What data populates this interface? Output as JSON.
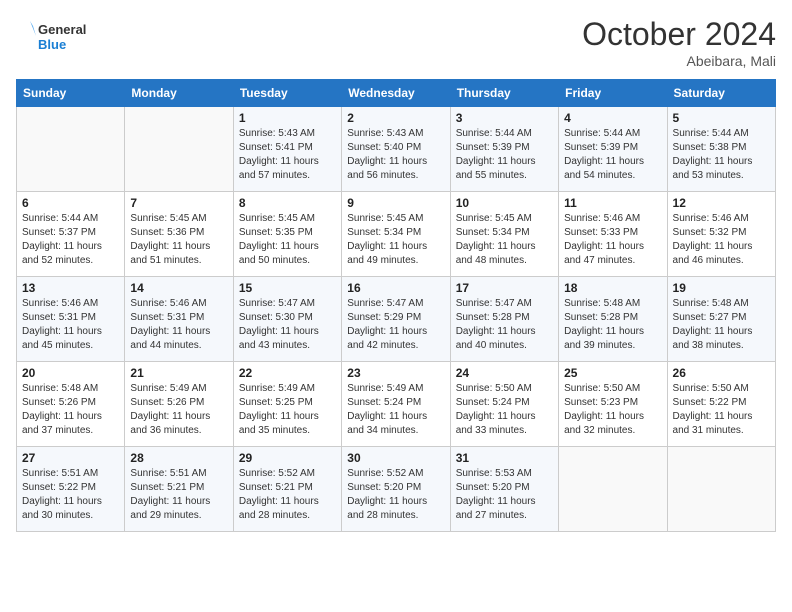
{
  "logo": {
    "text_general": "General",
    "text_blue": "Blue"
  },
  "header": {
    "month": "October 2024",
    "location": "Abeibara, Mali"
  },
  "weekdays": [
    "Sunday",
    "Monday",
    "Tuesday",
    "Wednesday",
    "Thursday",
    "Friday",
    "Saturday"
  ],
  "weeks": [
    [
      {
        "day": "",
        "sunrise": "",
        "sunset": "",
        "daylight": ""
      },
      {
        "day": "",
        "sunrise": "",
        "sunset": "",
        "daylight": ""
      },
      {
        "day": "1",
        "sunrise": "Sunrise: 5:43 AM",
        "sunset": "Sunset: 5:41 PM",
        "daylight": "Daylight: 11 hours and 57 minutes."
      },
      {
        "day": "2",
        "sunrise": "Sunrise: 5:43 AM",
        "sunset": "Sunset: 5:40 PM",
        "daylight": "Daylight: 11 hours and 56 minutes."
      },
      {
        "day": "3",
        "sunrise": "Sunrise: 5:44 AM",
        "sunset": "Sunset: 5:39 PM",
        "daylight": "Daylight: 11 hours and 55 minutes."
      },
      {
        "day": "4",
        "sunrise": "Sunrise: 5:44 AM",
        "sunset": "Sunset: 5:39 PM",
        "daylight": "Daylight: 11 hours and 54 minutes."
      },
      {
        "day": "5",
        "sunrise": "Sunrise: 5:44 AM",
        "sunset": "Sunset: 5:38 PM",
        "daylight": "Daylight: 11 hours and 53 minutes."
      }
    ],
    [
      {
        "day": "6",
        "sunrise": "Sunrise: 5:44 AM",
        "sunset": "Sunset: 5:37 PM",
        "daylight": "Daylight: 11 hours and 52 minutes."
      },
      {
        "day": "7",
        "sunrise": "Sunrise: 5:45 AM",
        "sunset": "Sunset: 5:36 PM",
        "daylight": "Daylight: 11 hours and 51 minutes."
      },
      {
        "day": "8",
        "sunrise": "Sunrise: 5:45 AM",
        "sunset": "Sunset: 5:35 PM",
        "daylight": "Daylight: 11 hours and 50 minutes."
      },
      {
        "day": "9",
        "sunrise": "Sunrise: 5:45 AM",
        "sunset": "Sunset: 5:34 PM",
        "daylight": "Daylight: 11 hours and 49 minutes."
      },
      {
        "day": "10",
        "sunrise": "Sunrise: 5:45 AM",
        "sunset": "Sunset: 5:34 PM",
        "daylight": "Daylight: 11 hours and 48 minutes."
      },
      {
        "day": "11",
        "sunrise": "Sunrise: 5:46 AM",
        "sunset": "Sunset: 5:33 PM",
        "daylight": "Daylight: 11 hours and 47 minutes."
      },
      {
        "day": "12",
        "sunrise": "Sunrise: 5:46 AM",
        "sunset": "Sunset: 5:32 PM",
        "daylight": "Daylight: 11 hours and 46 minutes."
      }
    ],
    [
      {
        "day": "13",
        "sunrise": "Sunrise: 5:46 AM",
        "sunset": "Sunset: 5:31 PM",
        "daylight": "Daylight: 11 hours and 45 minutes."
      },
      {
        "day": "14",
        "sunrise": "Sunrise: 5:46 AM",
        "sunset": "Sunset: 5:31 PM",
        "daylight": "Daylight: 11 hours and 44 minutes."
      },
      {
        "day": "15",
        "sunrise": "Sunrise: 5:47 AM",
        "sunset": "Sunset: 5:30 PM",
        "daylight": "Daylight: 11 hours and 43 minutes."
      },
      {
        "day": "16",
        "sunrise": "Sunrise: 5:47 AM",
        "sunset": "Sunset: 5:29 PM",
        "daylight": "Daylight: 11 hours and 42 minutes."
      },
      {
        "day": "17",
        "sunrise": "Sunrise: 5:47 AM",
        "sunset": "Sunset: 5:28 PM",
        "daylight": "Daylight: 11 hours and 40 minutes."
      },
      {
        "day": "18",
        "sunrise": "Sunrise: 5:48 AM",
        "sunset": "Sunset: 5:28 PM",
        "daylight": "Daylight: 11 hours and 39 minutes."
      },
      {
        "day": "19",
        "sunrise": "Sunrise: 5:48 AM",
        "sunset": "Sunset: 5:27 PM",
        "daylight": "Daylight: 11 hours and 38 minutes."
      }
    ],
    [
      {
        "day": "20",
        "sunrise": "Sunrise: 5:48 AM",
        "sunset": "Sunset: 5:26 PM",
        "daylight": "Daylight: 11 hours and 37 minutes."
      },
      {
        "day": "21",
        "sunrise": "Sunrise: 5:49 AM",
        "sunset": "Sunset: 5:26 PM",
        "daylight": "Daylight: 11 hours and 36 minutes."
      },
      {
        "day": "22",
        "sunrise": "Sunrise: 5:49 AM",
        "sunset": "Sunset: 5:25 PM",
        "daylight": "Daylight: 11 hours and 35 minutes."
      },
      {
        "day": "23",
        "sunrise": "Sunrise: 5:49 AM",
        "sunset": "Sunset: 5:24 PM",
        "daylight": "Daylight: 11 hours and 34 minutes."
      },
      {
        "day": "24",
        "sunrise": "Sunrise: 5:50 AM",
        "sunset": "Sunset: 5:24 PM",
        "daylight": "Daylight: 11 hours and 33 minutes."
      },
      {
        "day": "25",
        "sunrise": "Sunrise: 5:50 AM",
        "sunset": "Sunset: 5:23 PM",
        "daylight": "Daylight: 11 hours and 32 minutes."
      },
      {
        "day": "26",
        "sunrise": "Sunrise: 5:50 AM",
        "sunset": "Sunset: 5:22 PM",
        "daylight": "Daylight: 11 hours and 31 minutes."
      }
    ],
    [
      {
        "day": "27",
        "sunrise": "Sunrise: 5:51 AM",
        "sunset": "Sunset: 5:22 PM",
        "daylight": "Daylight: 11 hours and 30 minutes."
      },
      {
        "day": "28",
        "sunrise": "Sunrise: 5:51 AM",
        "sunset": "Sunset: 5:21 PM",
        "daylight": "Daylight: 11 hours and 29 minutes."
      },
      {
        "day": "29",
        "sunrise": "Sunrise: 5:52 AM",
        "sunset": "Sunset: 5:21 PM",
        "daylight": "Daylight: 11 hours and 28 minutes."
      },
      {
        "day": "30",
        "sunrise": "Sunrise: 5:52 AM",
        "sunset": "Sunset: 5:20 PM",
        "daylight": "Daylight: 11 hours and 28 minutes."
      },
      {
        "day": "31",
        "sunrise": "Sunrise: 5:53 AM",
        "sunset": "Sunset: 5:20 PM",
        "daylight": "Daylight: 11 hours and 27 minutes."
      },
      {
        "day": "",
        "sunrise": "",
        "sunset": "",
        "daylight": ""
      },
      {
        "day": "",
        "sunrise": "",
        "sunset": "",
        "daylight": ""
      }
    ]
  ]
}
